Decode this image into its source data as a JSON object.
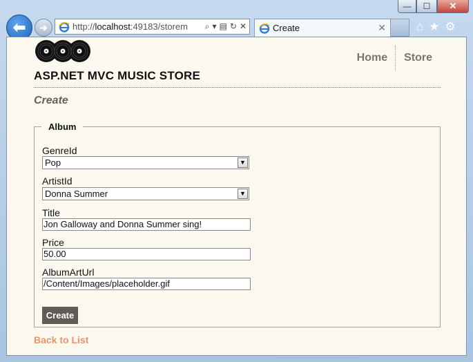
{
  "browser": {
    "url_prefix": "http://",
    "url_host": "localhost",
    "url_rest": ":49183/storem",
    "tab_title": "Create",
    "caption": {
      "minimize": "—",
      "maximize": "☐",
      "close": "✕"
    },
    "nav": {
      "back": "⬅",
      "forward": "➜"
    },
    "tools": {
      "search": "⌕",
      "dropdown": "▾",
      "compat": "▤",
      "refresh": "↻",
      "stop": "✕"
    },
    "tab_close": "✕",
    "icons": {
      "home": "⌂",
      "favorites": "★",
      "settings": "⚙"
    }
  },
  "site": {
    "title": "ASP.NET MVC MUSIC STORE",
    "nav": [
      {
        "label": "Home"
      },
      {
        "label": "Store"
      }
    ]
  },
  "page": {
    "heading": "Create",
    "legend": "Album",
    "fields": {
      "genre": {
        "label": "GenreId",
        "value": "Pop"
      },
      "artist": {
        "label": "ArtistId",
        "value": "Donna Summer"
      },
      "title": {
        "label": "Title",
        "value": "Jon Galloway and Donna Summer sing!"
      },
      "price": {
        "label": "Price",
        "value": "50.00"
      },
      "art": {
        "label": "AlbumArtUrl",
        "value": "/Content/Images/placeholder.gif"
      }
    },
    "submit_label": "Create",
    "back_label": "Back to List"
  },
  "colors": {
    "page_bg": "#fbf8f0",
    "nav_link": "#7d7567",
    "heading": "#6a6155",
    "button_bg": "#5f5b55",
    "back_link": "#e8956b"
  }
}
